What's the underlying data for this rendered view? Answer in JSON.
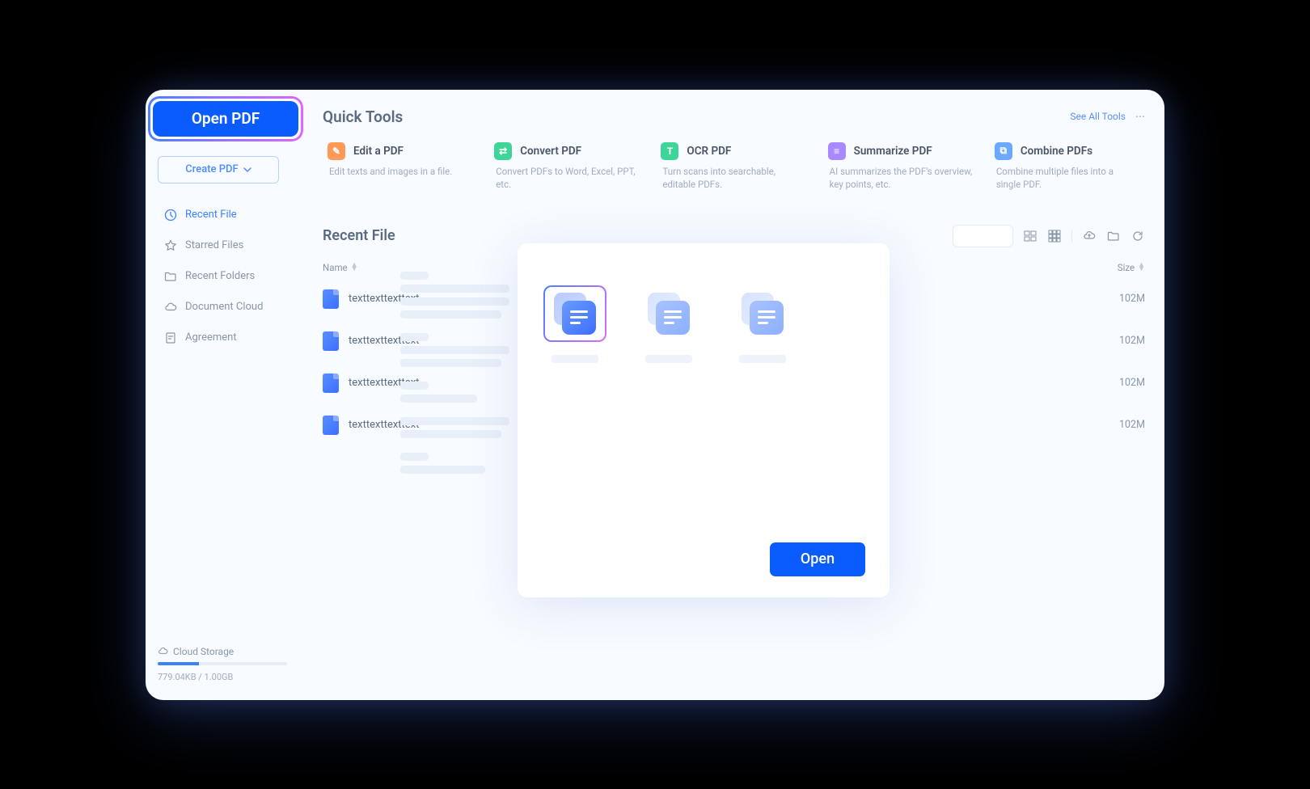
{
  "sidebar": {
    "open_pdf_label": "Open PDF",
    "create_pdf_label": "Create PDF",
    "nav": [
      {
        "label": "Recent File",
        "icon": "clock-icon",
        "active": true
      },
      {
        "label": "Starred Files",
        "icon": "star-icon",
        "active": false
      },
      {
        "label": "Recent Folders",
        "icon": "folder-icon",
        "active": false
      },
      {
        "label": "Document Cloud",
        "icon": "cloud-icon",
        "active": false
      },
      {
        "label": "Agreement",
        "icon": "document-icon",
        "active": false
      }
    ],
    "cloud_storage_label": "Cloud Storage",
    "cloud_usage": "779.04KB / 1.00GB"
  },
  "quick_tools": {
    "title": "Quick Tools",
    "see_all": "See All Tools",
    "items": [
      {
        "title": "Edit a PDF",
        "desc": "Edit texts and images in a file.",
        "color": "#ff9a56"
      },
      {
        "title": "Convert PDF",
        "desc": "Convert PDFs to Word, Excel, PPT, etc.",
        "color": "#3dd598"
      },
      {
        "title": "OCR PDF",
        "desc": "Turn scans into searchable, editable PDFs.",
        "color": "#3dd598"
      },
      {
        "title": "Summarize PDF",
        "desc": "AI summarizes the PDF's overview, key points, etc.",
        "color": "#a889ff"
      },
      {
        "title": "Combine PDFs",
        "desc": "Combine multiple files into a single PDF.",
        "color": "#6ba8ff"
      }
    ]
  },
  "recent": {
    "title": "Recent File",
    "col_name": "Name",
    "col_size": "Size",
    "rows": [
      {
        "name": "texttexttexttext",
        "size": "102M"
      },
      {
        "name": "texttexttexttext",
        "size": "102M"
      },
      {
        "name": "texttexttexttext",
        "size": "102M"
      },
      {
        "name": "texttexttexttext",
        "size": "102M"
      }
    ]
  },
  "modal": {
    "open_label": "Open"
  }
}
